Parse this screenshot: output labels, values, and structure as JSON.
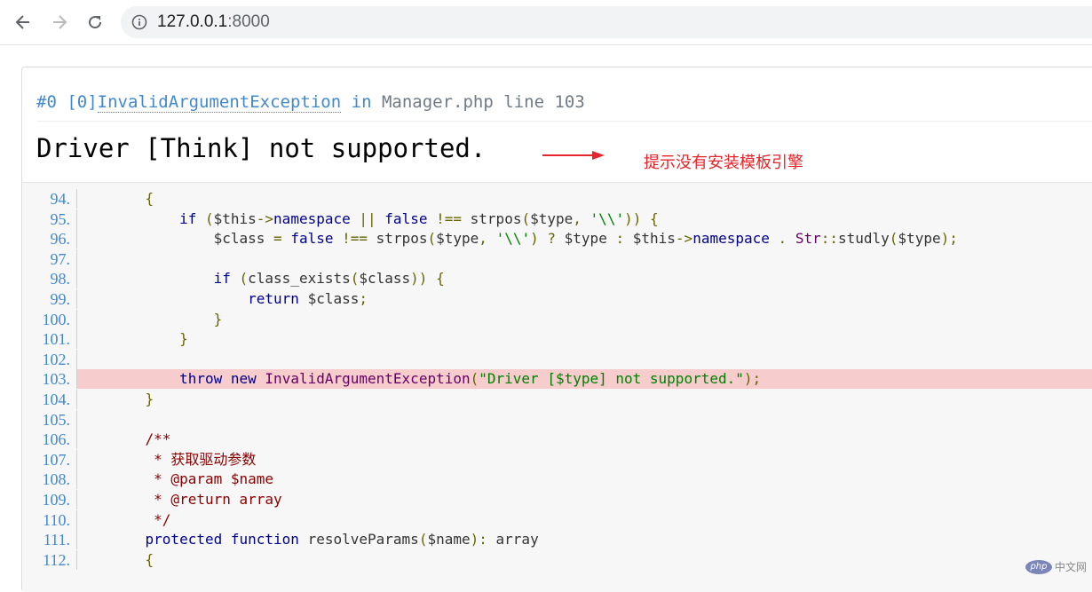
{
  "browser": {
    "url_host": "127.0.0.1",
    "url_port": ":8000"
  },
  "exception": {
    "frame": "#0 [0]",
    "class_name": "InvalidArgumentException",
    "in_word": "in",
    "location": "Manager.php line 103",
    "message": "Driver [Think] not supported."
  },
  "annotation": {
    "text": "提示没有安装模板引擎",
    "color": "#e6242b"
  },
  "source": {
    "active_line": "103.",
    "lines": [
      {
        "num": "94.",
        "html": "    <span class=\"pun\">{</span>"
      },
      {
        "num": "95.",
        "html": "        <span class=\"kwd\">if</span> <span class=\"pun\">(</span><span class=\"var\">$this</span><span class=\"pun\">-></span><span class=\"kwd\">namespace</span> <span class=\"pun\">||</span> <span class=\"kwd\">false</span> <span class=\"pun\">!==</span> <span class=\"pln\">strpos</span><span class=\"pun\">(</span><span class=\"var\">$type</span><span class=\"pun\">,</span> <span class=\"str\">'\\\\'</span><span class=\"pun\">))</span> <span class=\"pun\">{</span>"
      },
      {
        "num": "96.",
        "html": "            <span class=\"var\">$class</span> <span class=\"pun\">=</span> <span class=\"kwd\">false</span> <span class=\"pun\">!==</span> <span class=\"pln\">strpos</span><span class=\"pun\">(</span><span class=\"var\">$type</span><span class=\"pun\">,</span> <span class=\"str\">'\\\\'</span><span class=\"pun\">)</span> <span class=\"pun\">?</span> <span class=\"var\">$type</span> <span class=\"pun\">:</span> <span class=\"var\">$this</span><span class=\"pun\">-></span><span class=\"kwd\">namespace</span> <span class=\"pun\">.</span> <span class=\"typ\">Str</span><span class=\"pun\">::</span><span class=\"pln\">studly</span><span class=\"pun\">(</span><span class=\"var\">$type</span><span class=\"pun\">);</span>"
      },
      {
        "num": "97.",
        "html": ""
      },
      {
        "num": "98.",
        "html": "            <span class=\"kwd\">if</span> <span class=\"pun\">(</span><span class=\"pln\">class_exists</span><span class=\"pun\">(</span><span class=\"var\">$class</span><span class=\"pun\">))</span> <span class=\"pun\">{</span>"
      },
      {
        "num": "99.",
        "html": "                <span class=\"kwd\">return</span> <span class=\"var\">$class</span><span class=\"pun\">;</span>"
      },
      {
        "num": "100.",
        "html": "            <span class=\"pun\">}</span>"
      },
      {
        "num": "101.",
        "html": "        <span class=\"pun\">}</span>"
      },
      {
        "num": "102.",
        "html": ""
      },
      {
        "num": "103.",
        "html": "        <span class=\"kwd\">throw</span> <span class=\"kwd\">new</span> <span class=\"typ\">InvalidArgumentException</span><span class=\"pun\">(</span><span class=\"str\">\"Driver [$type] not supported.\"</span><span class=\"pun\">);</span>"
      },
      {
        "num": "104.",
        "html": "    <span class=\"pun\">}</span>"
      },
      {
        "num": "105.",
        "html": ""
      },
      {
        "num": "106.",
        "html": "    <span class=\"com\">/**</span>"
      },
      {
        "num": "107.",
        "html": "<span class=\"com\">     * 获取驱动参数</span>"
      },
      {
        "num": "108.",
        "html": "<span class=\"com\">     * @param $name</span>"
      },
      {
        "num": "109.",
        "html": "<span class=\"com\">     * @return array</span>"
      },
      {
        "num": "110.",
        "html": "<span class=\"com\">     */</span>"
      },
      {
        "num": "111.",
        "html": "    <span class=\"kwd\">protected</span> <span class=\"kwd\">function</span> <span class=\"pln\">resolveParams</span><span class=\"pun\">(</span><span class=\"var\">$name</span><span class=\"pun\">):</span> <span class=\"pln\">array</span>"
      },
      {
        "num": "112.",
        "html": "    <span class=\"pun\">{</span>"
      }
    ]
  },
  "watermark": {
    "logo": "php",
    "text": "中文网"
  }
}
